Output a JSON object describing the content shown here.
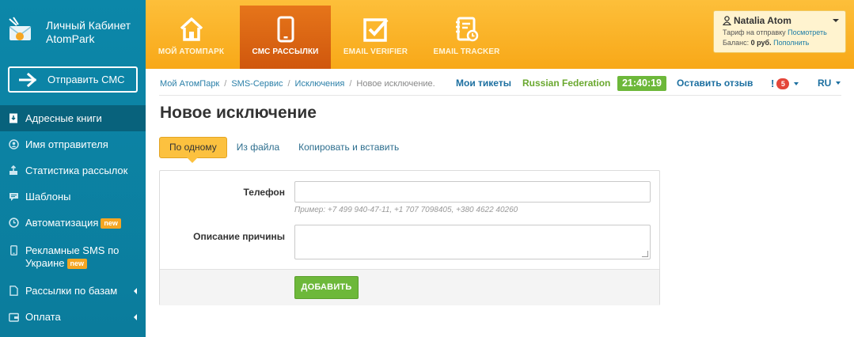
{
  "brand": {
    "line1": "Личный Кабинет",
    "line2": "AtomPark"
  },
  "sidebar": {
    "send_button": "Отправить СМС",
    "items": [
      {
        "label": "Адресные книги",
        "icon": "address-book-icon",
        "active": true
      },
      {
        "label": "Имя отправителя",
        "icon": "sender-name-icon"
      },
      {
        "label": "Статистика рассылок",
        "icon": "stats-icon"
      },
      {
        "label": "Шаблоны",
        "icon": "templates-icon"
      },
      {
        "label": "Автоматизация",
        "icon": "clock-icon",
        "badge": "new"
      },
      {
        "label": "Рекламные SMS по Украине",
        "label_line1": "Рекламные SMS по",
        "label_line2": "Украине",
        "icon": "mobile-icon",
        "badge": "new"
      },
      {
        "label": "Рассылки по базам",
        "icon": "document-icon"
      },
      {
        "label": "Оплата",
        "icon": "wallet-icon"
      }
    ]
  },
  "topnav": {
    "tabs": [
      {
        "label": "МОЙ АТОМПАРК",
        "icon": "home-icon"
      },
      {
        "label": "СМС РАССЫЛКИ",
        "icon": "phone-icon",
        "active": true
      },
      {
        "label": "EMAIL VERIFIER",
        "icon": "checkbox-icon"
      },
      {
        "label": "EMAIL TRACKER",
        "icon": "tracker-icon"
      }
    ]
  },
  "user": {
    "name": "Natalia Atom",
    "tariff_label": "Тариф на отправку",
    "tariff_link": "Посмотреть",
    "balance_label": "Баланс:",
    "balance_value": "0 руб.",
    "balance_link": "Пополнить"
  },
  "breadcrumb": [
    "Мой АтомПарк",
    "SMS-Сервис",
    "Исключения",
    "Новое исключение."
  ],
  "header_links": {
    "tickets": "Мои тикеты",
    "country": "Russian Federation",
    "time": "21:40:19",
    "feedback": "Оставить отзыв",
    "notif_symbol": "!",
    "notifications": "5",
    "language": "RU"
  },
  "page": {
    "title": "Новое исключение",
    "subtabs": [
      "По одному",
      "Из файла",
      "Копировать и вставить"
    ],
    "form": {
      "phone_label": "Телефон",
      "phone_value": "",
      "phone_hint": "Пример: +7 499 940-47-11, +1 707 7098405, +380 4622 40260",
      "reason_label": "Описание причины",
      "reason_value": "",
      "submit": "ДОБАВИТЬ"
    }
  },
  "colors": {
    "sidebar": "#0c87a9",
    "sidebar_active": "#08627c",
    "topbar": "#fdbf3a",
    "topbar_active_tab": "#d0570d",
    "accent_green": "#6db83a",
    "link_blue": "#1c6fa0",
    "notif_red": "#e4463a"
  }
}
